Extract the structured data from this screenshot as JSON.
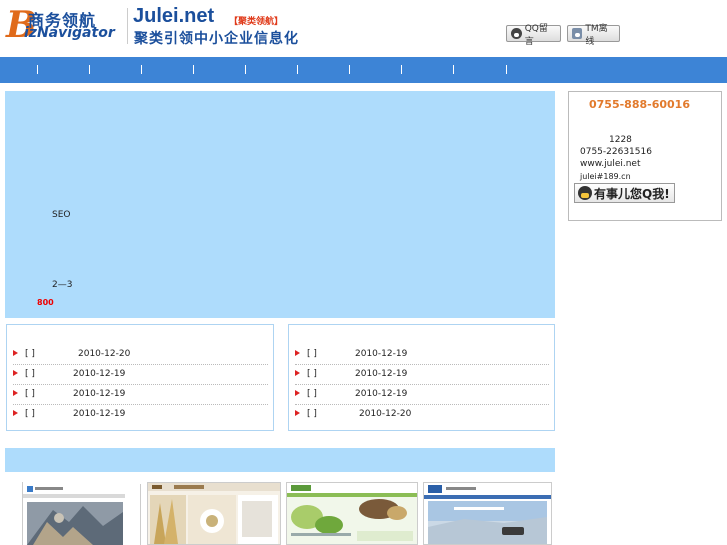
{
  "header": {
    "logo_letter": "B",
    "logo_cn": "商务领航",
    "logo_en": "izNavigator",
    "brand_title": "Julei.net",
    "brand_tag": "【聚类领航】",
    "brand_slogan": "聚类引领中小企业信息化",
    "qq_button": "QQ留言",
    "tm_button": "TM离线"
  },
  "banner": {
    "line_seo": "SEO",
    "line_days": "2—3",
    "price": "800"
  },
  "contact": {
    "phone": "0755-888-60016",
    "address": "1228",
    "fax": "0755-22631516",
    "website": "www.julei.net",
    "email": "julei#189.cn",
    "qq_button": "有事儿您Q我!"
  },
  "news_left": [
    {
      "tag": "[    ]",
      "date": "2010-12-20"
    },
    {
      "tag": "[    ]",
      "date": "2010-12-19"
    },
    {
      "tag": "[    ]",
      "date": "2010-12-19"
    },
    {
      "tag": "[    ]",
      "date": "2010-12-19"
    }
  ],
  "news_right": [
    {
      "tag": "[    ]",
      "date": "2010-12-19"
    },
    {
      "tag": "[    ]",
      "date": "2010-12-19"
    },
    {
      "tag": "[    ]",
      "date": "2010-12-19"
    },
    {
      "tag": "[    ]",
      "date": "2010-12-20"
    }
  ],
  "colors": {
    "nav": "#3d84d6",
    "panel": "#aedcfc",
    "accent": "#e27a2c"
  }
}
